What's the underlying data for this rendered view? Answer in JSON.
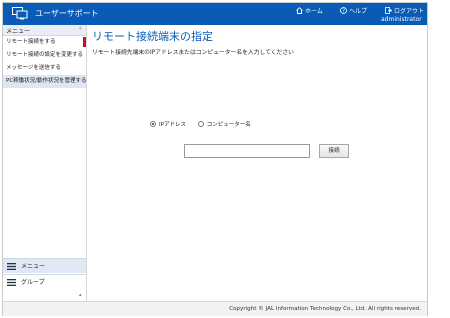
{
  "header": {
    "app_title": "ユーザーサポート",
    "home_label": "ホーム",
    "help_label": "ヘルプ",
    "logout_label": "ログアウト",
    "user_name": "administrator",
    "bg_color": "#0a5bb5"
  },
  "sidebar": {
    "title": "メニュー",
    "collapse": "‹",
    "items": [
      {
        "label": "リモート接続をする"
      },
      {
        "label": "リモート接続の設定を変更する"
      },
      {
        "label": "メッセージを送信する"
      },
      {
        "label": "PC稼働状況/動作状況を管理するIF"
      }
    ],
    "bottom_menu": "メニュー",
    "bottom_group": "グループ",
    "scroll_arrow": "▴"
  },
  "main": {
    "title": "リモート接続端末の指定",
    "instructions": "リモート接続先端末のIPアドレスまたはコンピューター名を入力してください",
    "radio_ip": "IPアドレス",
    "radio_name": "コンピューター名",
    "input_value": "",
    "input_placeholder": "",
    "connect_label": "接続"
  },
  "footer": {
    "copyright": "Copyright © JAL Information Technology Co., Ltd. All rights reserved."
  }
}
